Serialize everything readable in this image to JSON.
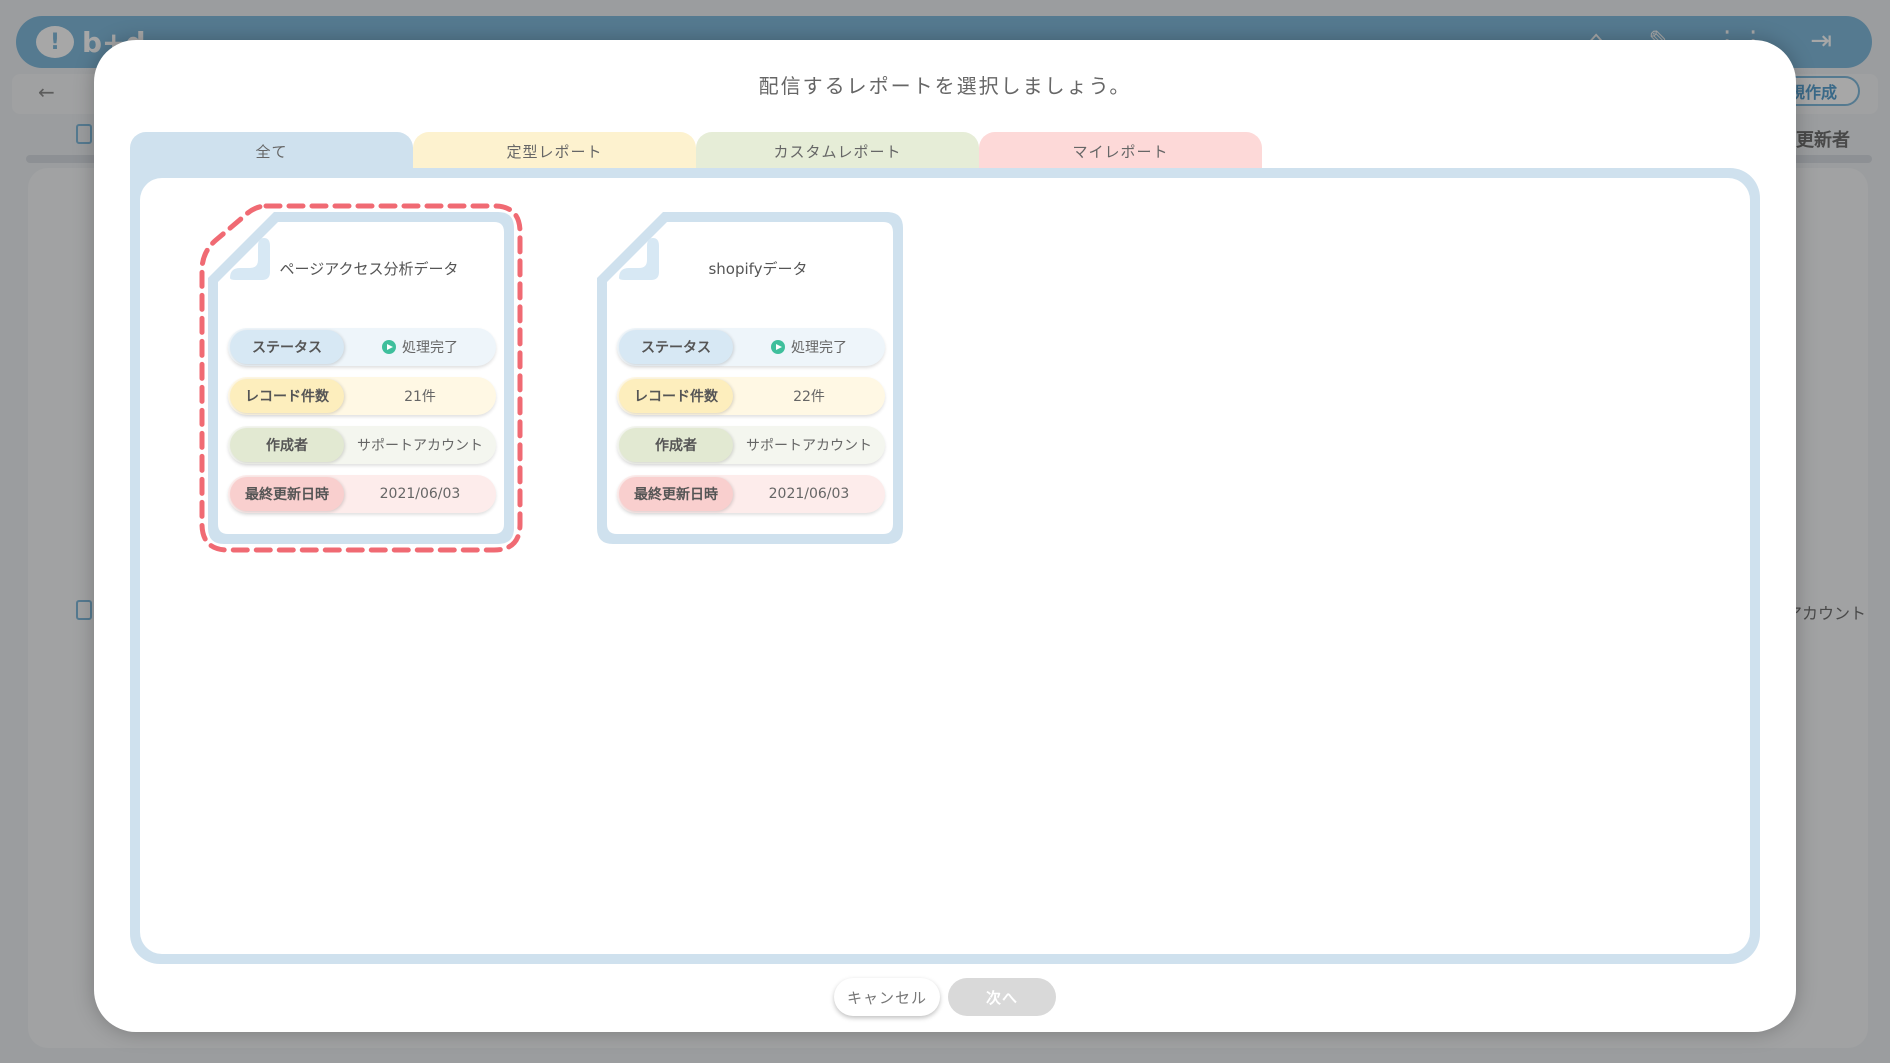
{
  "background": {
    "logo_text": "b+d",
    "back_label": "←",
    "create_button": "新規作成",
    "column_header": "更新者",
    "row_author": "アカウント",
    "header_icons": [
      "home-icon",
      "wrench-icon",
      "grid-icon",
      "logout-icon"
    ]
  },
  "modal": {
    "title": "配信するレポートを選択しましょう。",
    "tabs": [
      {
        "label": "全て",
        "color": "#cfe1ee",
        "active": true
      },
      {
        "label": "定型レポート",
        "color": "#fdf2cf",
        "active": false
      },
      {
        "label": "カスタムレポート",
        "color": "#e6edd7",
        "active": false
      },
      {
        "label": "マイレポート",
        "color": "#fdd9d8",
        "active": false
      }
    ],
    "cards": [
      {
        "title": "ページアクセス分析データ",
        "selected": true,
        "status_label": "ステータス",
        "status_value": "処理完了",
        "count_label": "レコード件数",
        "count_value": "21件",
        "author_label": "作成者",
        "author_value": "サポートアカウント",
        "date_label": "最終更新日時",
        "date_value": "2021/06/03"
      },
      {
        "title": "shopifyデータ",
        "selected": false,
        "status_label": "ステータス",
        "status_value": "処理完了",
        "count_label": "レコード件数",
        "count_value": "22件",
        "author_label": "作成者",
        "author_value": "サポートアカウント",
        "date_label": "最終更新日時",
        "date_value": "2021/06/03"
      }
    ],
    "cancel_label": "キャンセル",
    "next_label": "次へ"
  },
  "colors": {
    "accent": "#6aaed6",
    "selected_outline": "#f06a73",
    "status_ok": "#3fbf9c"
  }
}
